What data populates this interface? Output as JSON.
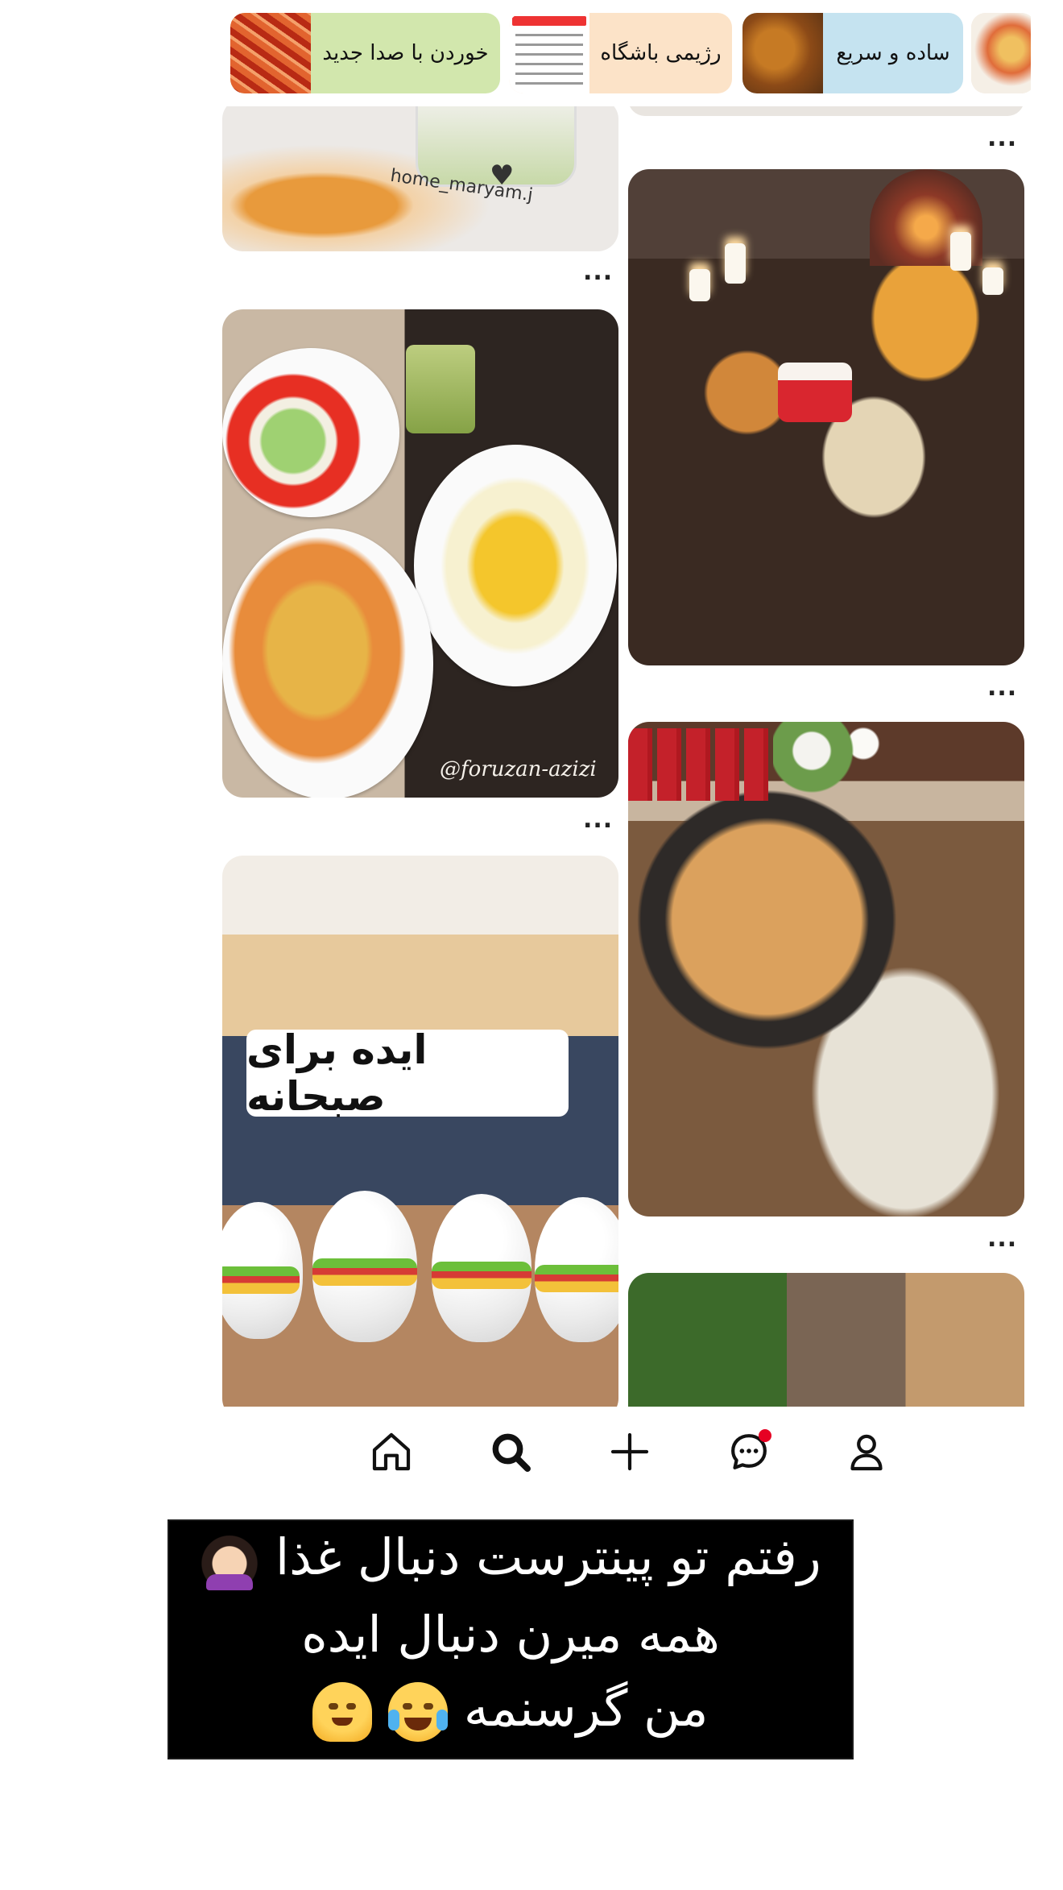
{
  "chips": [
    {
      "label": "خوردن با صدا جدید",
      "thumb_icon": "spicy-shrimp-thumb"
    },
    {
      "label": "رژیمی باشگاه",
      "thumb_icon": "nutrition-table-thumb",
      "thumb_title": "غول های تغذیه بدنسازان"
    },
    {
      "label": "ساده و سریع",
      "thumb_icon": "fried-chicken-thumb"
    },
    {
      "label": "",
      "thumb_icon": "soup-thumb"
    }
  ],
  "pins": {
    "dessert": {
      "watermark": "home_maryam.j"
    },
    "rice": {
      "watermark": "@foruzan-azizi"
    },
    "breakfast": {
      "caption": "ایده برای صبحانه"
    },
    "party": {},
    "pizza": {},
    "salad": {},
    "more_label": "..."
  },
  "tabbar": {
    "items": [
      "home-icon",
      "search-icon",
      "create-icon",
      "messages-icon",
      "profile-icon"
    ],
    "notification_color": "#e60023"
  },
  "story": {
    "line1": "رفتم تو پینترست دنبال غذا",
    "line2": "همه میرن دنبال ایده",
    "line3": "من گرسنمه",
    "emojis": [
      "facepalm-woman-emoji",
      "laughing-tears-emoji",
      "melting-face-emoji"
    ]
  }
}
